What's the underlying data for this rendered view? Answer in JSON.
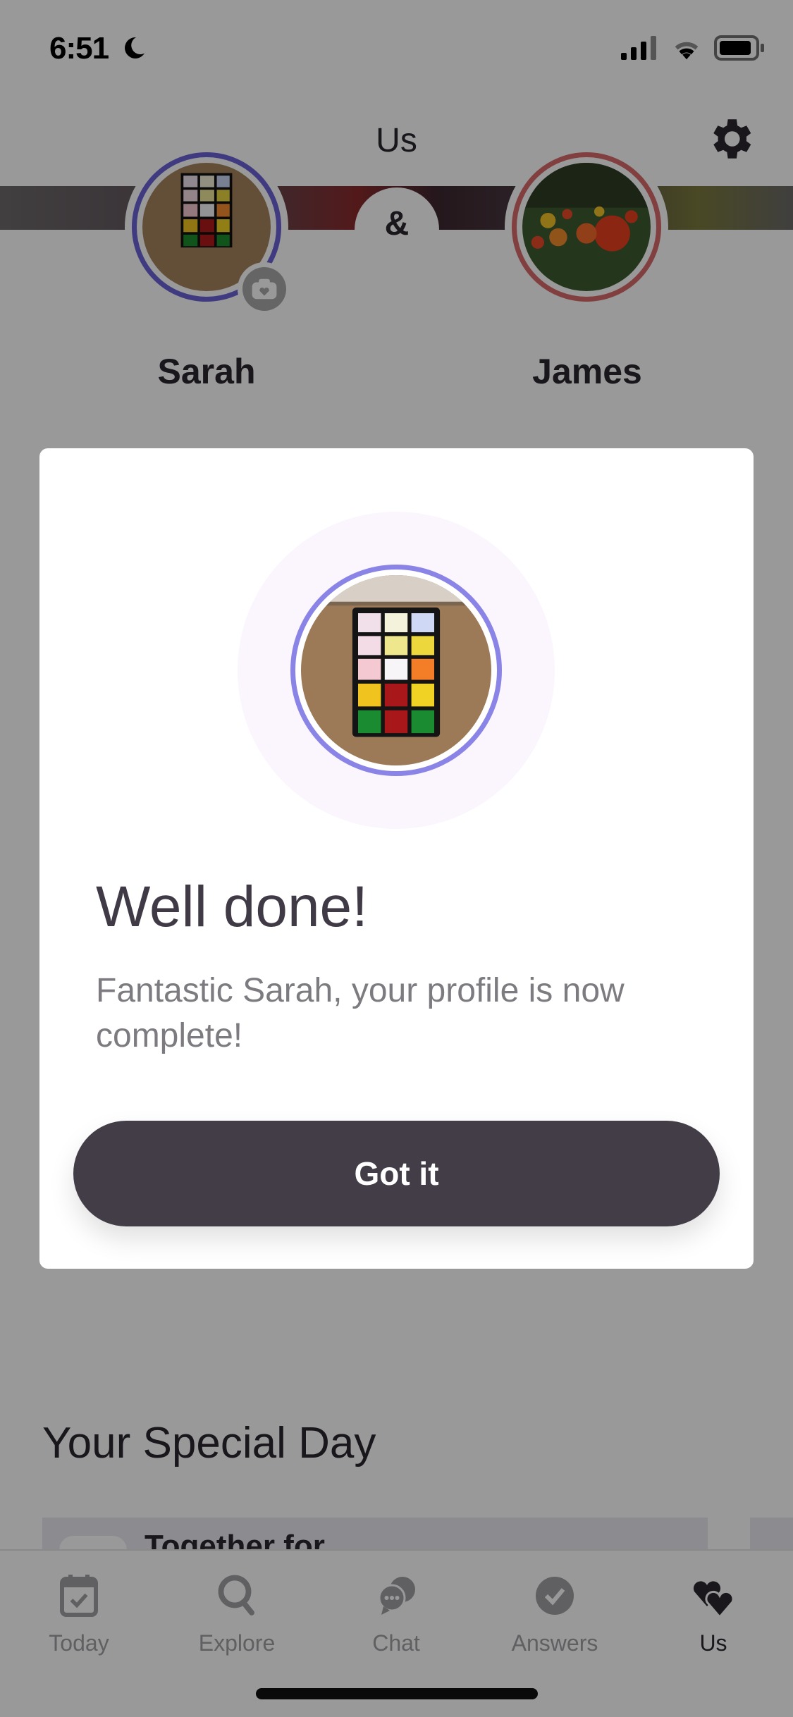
{
  "status_bar": {
    "time": "6:51",
    "focus_icon": "moon-icon",
    "signal_icon": "cellular-signal-icon",
    "wifi_icon": "wifi-icon",
    "battery_icon": "battery-icon"
  },
  "nav": {
    "title": "Us",
    "settings_icon": "gear-icon"
  },
  "couple": {
    "separator": "&",
    "partner_one": {
      "name": "Sarah",
      "ring_color": "#6b63d6",
      "photo": "rubiks-cube-photo"
    },
    "partner_two": {
      "name": "James",
      "ring_color": "#d96a6a",
      "photo": "tulip-garden-photo"
    },
    "camera_badge_icon": "camera-heart-icon"
  },
  "special_day": {
    "title": "Your Special Day",
    "card_label": "Together for"
  },
  "tab_bar": {
    "tabs": [
      {
        "label": "Today",
        "icon": "calendar-check-icon",
        "active": false
      },
      {
        "label": "Explore",
        "icon": "search-icon",
        "active": false
      },
      {
        "label": "Chat",
        "icon": "chat-bubbles-icon",
        "active": false
      },
      {
        "label": "Answers",
        "icon": "check-circle-icon",
        "active": false
      },
      {
        "label": "Us",
        "icon": "hearts-icon",
        "active": true
      }
    ]
  },
  "modal": {
    "title": "Well done!",
    "message": "Fantastic Sarah, your profile is now complete!",
    "button_label": "Got it",
    "avatar_ring_color": "#8a84e6",
    "button_color": "#433d48"
  }
}
